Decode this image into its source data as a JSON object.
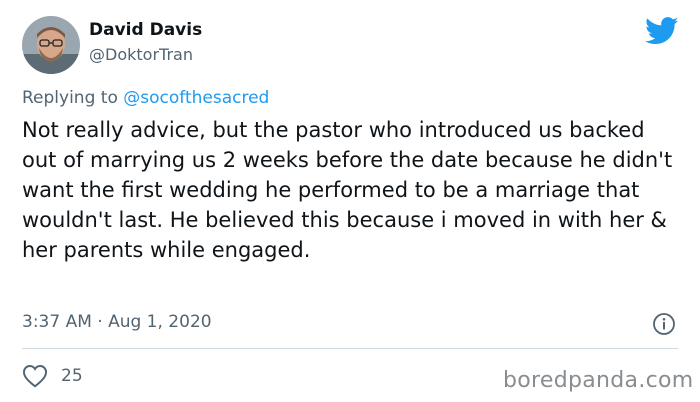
{
  "author": {
    "name": "David Davis",
    "handle": "@DoktorTran",
    "avatar_icon": "user-avatar"
  },
  "reply": {
    "prefix": "Replying to",
    "mention": "@socofthesacred"
  },
  "tweet": {
    "text": "Not really advice, but the pastor who introduced us backed out of marrying us 2 weeks before the date because he didn't want the first wedding he performed to be a marriage that wouldn't last. He believed this because i moved in with her & her parents while engaged."
  },
  "meta": {
    "timestamp": "3:37 AM · Aug 1, 2020"
  },
  "stats": {
    "likes": "25"
  },
  "watermark": "boredpanda.com",
  "icons": {
    "brand": "twitter-bird-icon",
    "info": "info-icon",
    "like": "heart-icon"
  },
  "colors": {
    "brand": "#1d9bf0",
    "text": "#0f1419",
    "secondary": "#536471",
    "divider": "#cfd9de"
  }
}
